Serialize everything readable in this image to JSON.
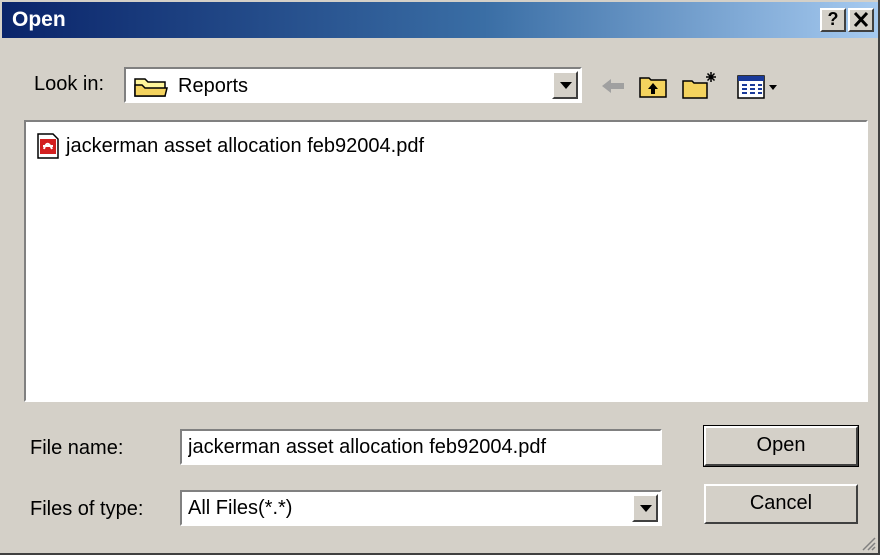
{
  "window": {
    "title": "Open",
    "help_label": "?",
    "close_label": "✕"
  },
  "look_in": {
    "label": "Look in:",
    "value": "Reports"
  },
  "toolbar": {
    "back_icon": "back-arrow-icon",
    "up_icon": "up-folder-icon",
    "new_folder_icon": "new-folder-icon",
    "view_menu_icon": "view-menu-icon"
  },
  "files": [
    {
      "name": "jackerman asset allocation feb92004.pdf",
      "icon": "pdf-file-icon"
    }
  ],
  "file_name": {
    "label": "File name:",
    "value": "jackerman asset allocation feb92004.pdf"
  },
  "file_type": {
    "label": "Files of type:",
    "value": "All Files(*.*)"
  },
  "buttons": {
    "open": "Open",
    "cancel": "Cancel"
  },
  "colors": {
    "dialog_face": "#d4d0c8",
    "title_start": "#0a246a",
    "title_end": "#a6caf0"
  }
}
